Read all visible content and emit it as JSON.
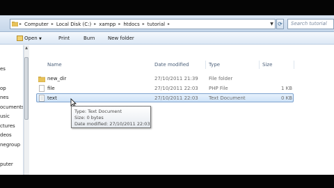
{
  "address": {
    "crumbs": [
      "Computer",
      "Local Disk (C:)",
      "xampp",
      "htdocs",
      "tutorial"
    ],
    "search_placeholder": "Search tutorial"
  },
  "toolbar": {
    "open_label": "Open",
    "print_label": "Print",
    "burn_label": "Burn",
    "new_folder_label": "New folder"
  },
  "nav": {
    "items": [
      "es",
      "op",
      "nes",
      "ocuments",
      "usic",
      "ctures",
      "deos",
      "negroup",
      "puter"
    ]
  },
  "columns": {
    "name": "Name",
    "date": "Date modified",
    "type": "Type",
    "size": "Size"
  },
  "files": [
    {
      "name": "new_dir",
      "date": "27/10/2011 21:39",
      "type": "File folder",
      "size": "",
      "icon": "folder-icon"
    },
    {
      "name": "file",
      "date": "27/10/2011 22:03",
      "type": "PHP File",
      "size": "1 KB",
      "icon": "php-file-icon"
    },
    {
      "name": "text",
      "date": "27/10/2011 22:03",
      "type": "Text Document",
      "size": "0 KB",
      "icon": "text-file-icon"
    }
  ],
  "tooltip": {
    "type_line": "Type: Text Document",
    "size_line": "Size: 0 bytes",
    "date_line": "Date modified: 27/10/2011 22:03"
  },
  "colors": {
    "selection": "#cfe3f8",
    "header_text": "#4c607a",
    "folder": "#e8c25a"
  }
}
